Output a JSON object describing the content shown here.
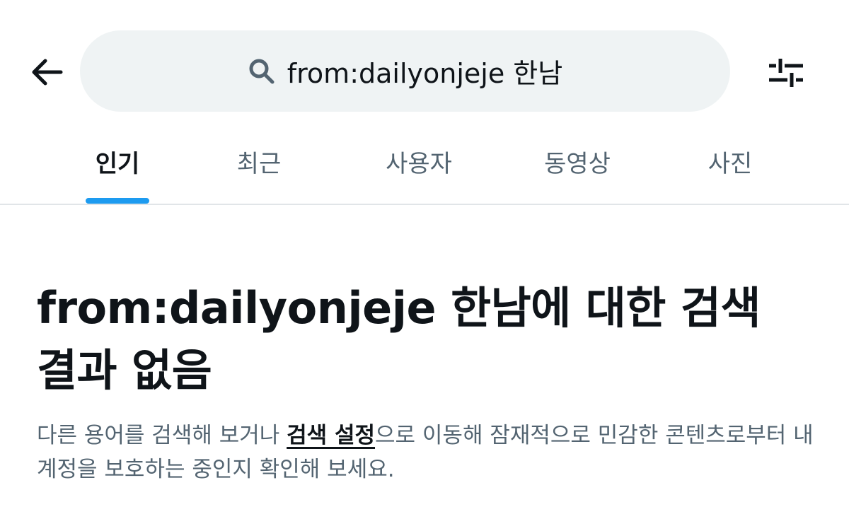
{
  "header": {
    "back_icon": "arrow-left-icon",
    "search": {
      "icon": "search-icon",
      "query": "from:dailyonjeje 한남"
    },
    "filter_icon": "sliders-icon"
  },
  "tabs": [
    {
      "label": "인기",
      "active": true
    },
    {
      "label": "최근",
      "active": false
    },
    {
      "label": "사용자",
      "active": false
    },
    {
      "label": "동영상",
      "active": false
    },
    {
      "label": "사진",
      "active": false
    }
  ],
  "result": {
    "title": "from:dailyonjeje 한남에 대한 검색 결과 없음",
    "desc_before": "다른 용어를 검색해 보거나 ",
    "desc_link": "검색 설정",
    "desc_after": "으로 이동해 잠재적으로 민감한 콘텐츠로부터 내 계정을 보호하는 중인지 확인해 보세요."
  },
  "colors": {
    "accent": "#1d9bf0",
    "text_primary": "#0f1419",
    "text_secondary": "#536471",
    "search_bg": "#eff3f4",
    "divider": "#e1e5e8"
  }
}
